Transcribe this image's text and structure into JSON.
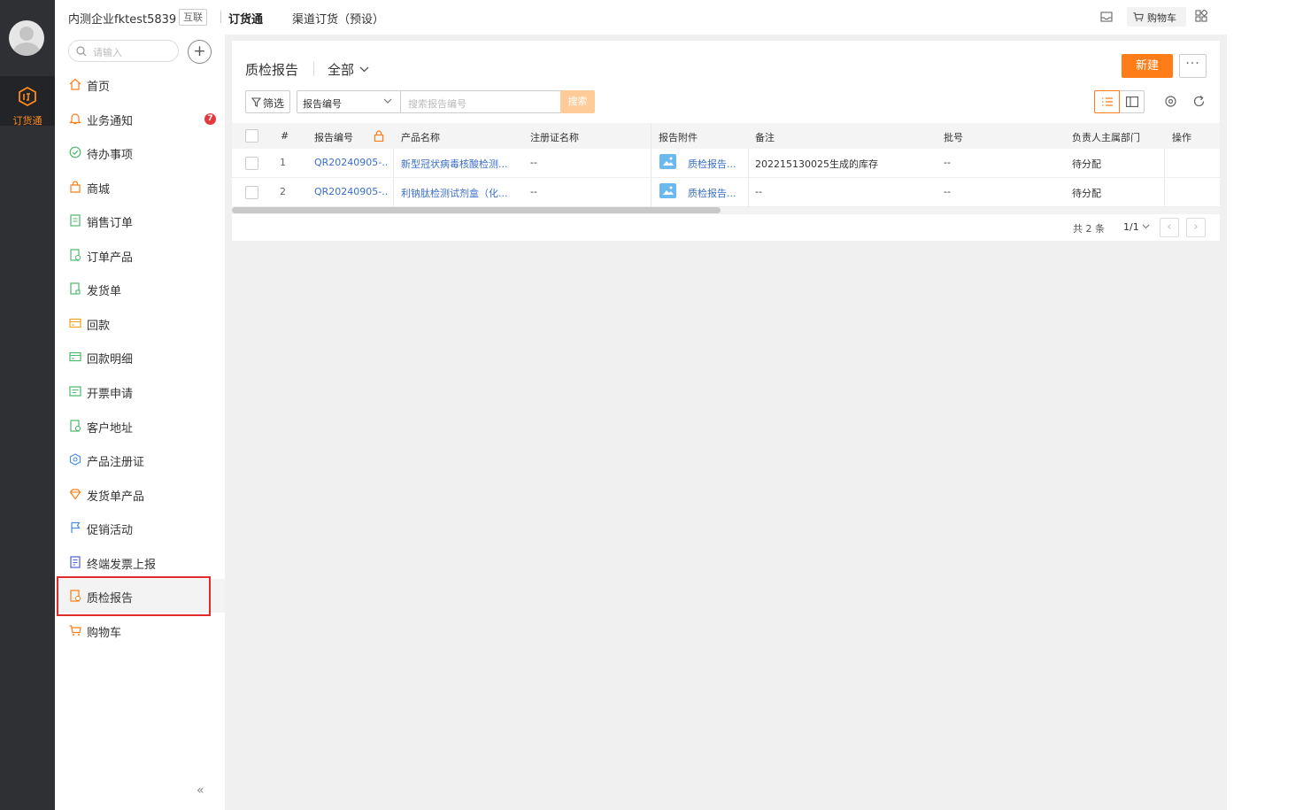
{
  "rail": {
    "app_label": "订货通"
  },
  "sidebar": {
    "company": "内测企业fktest5839",
    "company_tag": "互联",
    "search_placeholder": "请输入",
    "add_symbol": "+",
    "collapse_symbol": "«",
    "items": [
      {
        "label": "首页",
        "icon": "home-icon"
      },
      {
        "label": "业务通知",
        "icon": "bell-icon",
        "badge": "7"
      },
      {
        "label": "待办事项",
        "icon": "check-circle-icon"
      },
      {
        "label": "商城",
        "icon": "shopping-bag-icon"
      },
      {
        "label": "销售订单",
        "icon": "order-doc-icon"
      },
      {
        "label": "订单产品",
        "icon": "order-product-icon"
      },
      {
        "label": "发货单",
        "icon": "delivery-doc-icon"
      },
      {
        "label": "回款",
        "icon": "payment-icon"
      },
      {
        "label": "回款明细",
        "icon": "payment-detail-icon"
      },
      {
        "label": "开票申请",
        "icon": "invoice-icon"
      },
      {
        "label": "客户地址",
        "icon": "address-icon"
      },
      {
        "label": "产品注册证",
        "icon": "certificate-icon"
      },
      {
        "label": "发货单产品",
        "icon": "delivery-product-icon"
      },
      {
        "label": "促销活动",
        "icon": "flag-icon"
      },
      {
        "label": "终端发票上报",
        "icon": "terminal-invoice-icon"
      },
      {
        "label": "质检报告",
        "icon": "quality-report-icon"
      },
      {
        "label": "购物车",
        "icon": "cart-icon"
      }
    ]
  },
  "topbar": {
    "tab_active": "订货通",
    "tab_other": "渠道订货（预设）",
    "cart_label": "购物车"
  },
  "main": {
    "title": "质检报告",
    "view": "全部",
    "new_button": "新建",
    "more_button": "···",
    "filter_button": "筛选",
    "search_field": "报告编号",
    "search_placeholder": "搜索报告编号",
    "search_button": "搜索"
  },
  "table": {
    "columns": [
      "#",
      "报告编号",
      "产品名称",
      "注册证名称",
      "报告附件",
      "备注",
      "批号",
      "负责人主属部门",
      "操作"
    ],
    "rows": [
      {
        "index": "1",
        "report_no": "QR20240905-...",
        "product": "新型冠状病毒核酸检测...",
        "cert": "--",
        "attachment": "质检报告...",
        "remark": "202215130025生成的库存",
        "batch": "--",
        "dept": "待分配"
      },
      {
        "index": "2",
        "report_no": "QR20240905-...",
        "product": "利钠肽检测试剂盒（化...",
        "cert": "--",
        "attachment": "质检报告...",
        "remark": "--",
        "batch": "--",
        "dept": "待分配"
      }
    ]
  },
  "pagination": {
    "total": "共 2 条",
    "page": "1/1",
    "prev": "‹",
    "next": "›"
  },
  "colors": {
    "accent": "#ff7d18",
    "link": "#3a6ec9",
    "rail": "#2f3033",
    "badge": "#e6393e",
    "highlight": "#e02b2b"
  }
}
